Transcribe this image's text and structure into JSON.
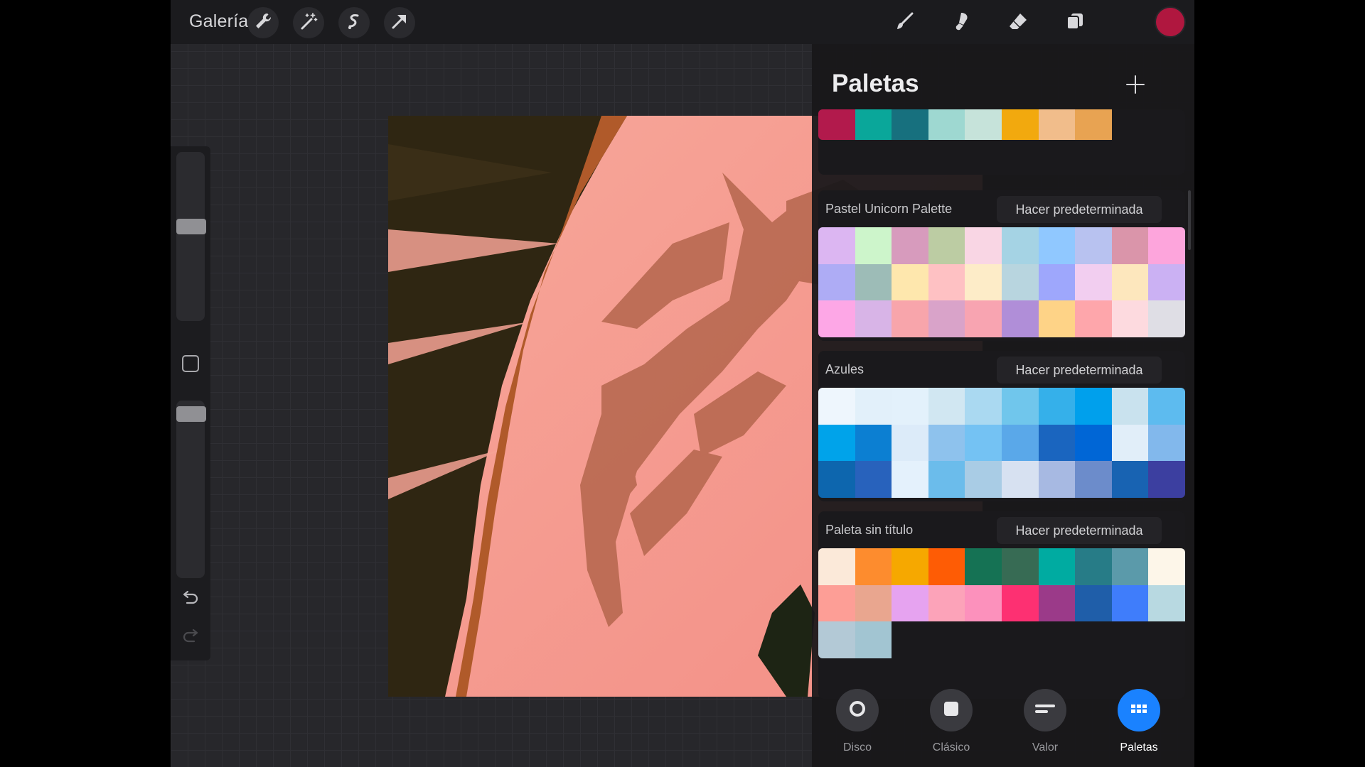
{
  "topbar": {
    "gallery_label": "Galería",
    "left_tools": [
      "wrench-icon",
      "magic-wand-icon",
      "selection-icon",
      "transform-arrow-icon"
    ],
    "right_tools": [
      "brush-icon",
      "smudge-icon",
      "eraser-icon",
      "layers-icon"
    ],
    "current_color": "#b0173f"
  },
  "panel": {
    "title": "Paletas",
    "make_default_label": "Hacer predeterminada",
    "palettes": [
      {
        "name": "",
        "swatches": [
          "#b21a4c",
          "#0aa79a",
          "#17707e",
          "#9ed8d1",
          "#c6e3da",
          "#f2a90e",
          "#f1bd8b",
          "#e8a352"
        ]
      },
      {
        "name": "Pastel Unicorn Palette",
        "swatches": [
          "#dcb6f2",
          "#cdf5cb",
          "#d79bbd",
          "#bccca3",
          "#f9d6e4",
          "#a5d3e4",
          "#90c8ff",
          "#b8c2f0",
          "#da95aa",
          "#fda5dc",
          "#aeacf5",
          "#9dbcb7",
          "#fee7ad",
          "#fec1c3",
          "#fdecc8",
          "#b8d5df",
          "#9ea7fc",
          "#f2cef0",
          "#fde7bd",
          "#cbb1f3",
          "#fda7e6",
          "#d8b4e7",
          "#f8a5ab",
          "#d9a3c9",
          "#f8a4b1",
          "#b08ed8",
          "#fed387",
          "#fea6ab",
          "#fddadf",
          "#dfdee5"
        ]
      },
      {
        "name": "Azules",
        "swatches": [
          "#eef6fd",
          "#e2f0fa",
          "#e3f1fb",
          "#d1e7f2",
          "#aad9f1",
          "#70c6ec",
          "#35b0ea",
          "#00a0ec",
          "#c9e2ee",
          "#5dbbef",
          "#00a3ea",
          "#0c7fd2",
          "#dcebf9",
          "#8ec2ed",
          "#74c2f3",
          "#5aa8e9",
          "#1a65bf",
          "#0066d6",
          "#e1eef9",
          "#82b8ec",
          "#0d66ae",
          "#2862bc",
          "#e4f1fc",
          "#6bbceb",
          "#a9cce5",
          "#d7e1f1",
          "#a7b9e2",
          "#6c8ccb",
          "#1863b2",
          "#3c3fa0"
        ]
      },
      {
        "name": "Paleta sin título",
        "swatches": [
          "#fbe9d9",
          "#fd8c2e",
          "#f6a800",
          "#fe5c05",
          "#157254",
          "#376b54",
          "#00aba1",
          "#277c87",
          "#5b9aaa",
          "#fdf6e9",
          "#fd9e96",
          "#e9a68f",
          "#e6a3f0",
          "#fca3b9",
          "#fc91bc",
          "#fd3072",
          "#9b3a89",
          "#1f5ea9",
          "#3f7dfb",
          "#b8d9e1",
          "#b3c9d6",
          "#a2c5d2"
        ]
      }
    ],
    "tabs": [
      {
        "label": "Disco",
        "icon": "disc-icon"
      },
      {
        "label": "Clásico",
        "icon": "classic-square-icon"
      },
      {
        "label": "Valor",
        "icon": "value-sliders-icon"
      },
      {
        "label": "Paletas",
        "icon": "palettes-grid-icon",
        "active": true
      }
    ]
  }
}
